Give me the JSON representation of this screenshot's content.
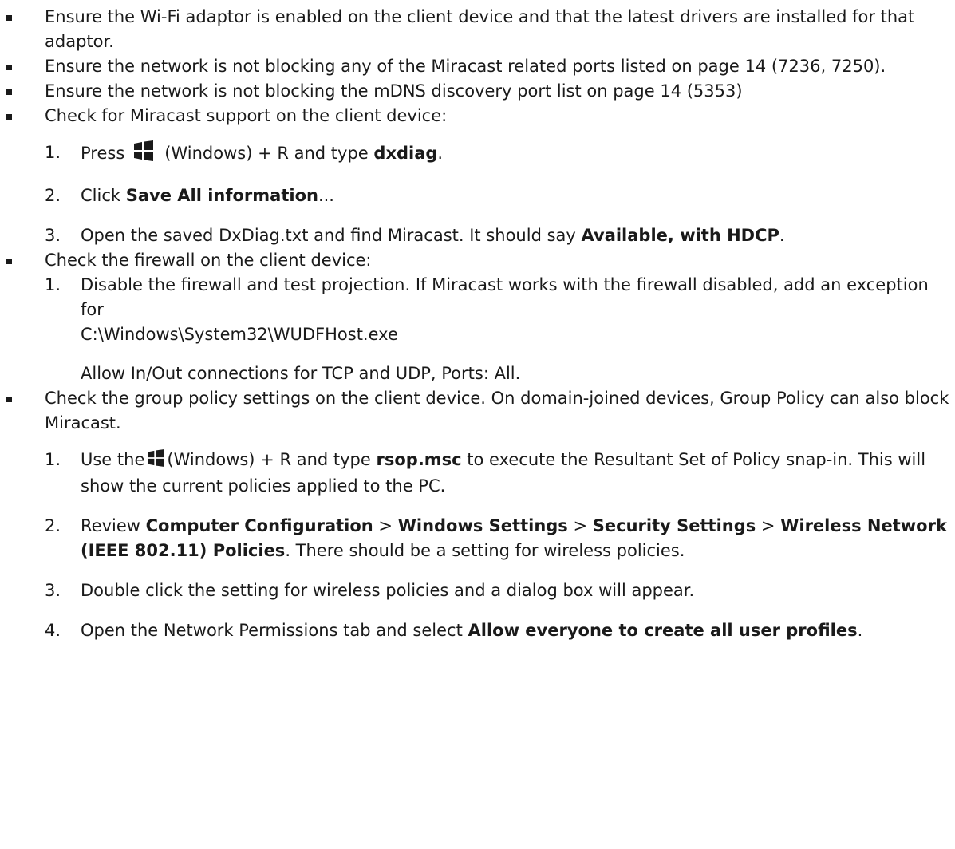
{
  "bullets": {
    "b1": "Ensure the Wi-Fi adaptor is enabled on the client device and that the latest drivers are installed for that adaptor.",
    "b2": "Ensure the network is not blocking any of the Miracast related ports listed on page 14 (7236, 7250).",
    "b3": "Ensure the network is not blocking the mDNS discovery port list on page 14 (5353)",
    "b4": "Check for Miracast support on the client device:",
    "b5": "Check the firewall on the client device:",
    "b6": "Check the group policy settings on the client device. On domain-joined devices, Group Policy can also block Miracast."
  },
  "miracast_steps": {
    "s1": {
      "num": "1.",
      "pre": "Press",
      "icon": "windows-logo-icon",
      "mid": "(Windows) + R and type ",
      "bold": "dxdiag",
      "post": "."
    },
    "s2": {
      "num": "2.",
      "pre": "Click ",
      "bold": "Save All information",
      "post": "..."
    },
    "s3": {
      "num": "3.",
      "pre": "Open the saved DxDiag.txt and find Miracast. It should say ",
      "bold": "Available, with HDCP",
      "post": "."
    }
  },
  "firewall_steps": {
    "s1": {
      "num": "1.",
      "text": "Disable the firewall and test projection. If Miracast works with the firewall disabled, add an exception for",
      "path": "C:\\Windows\\System32\\WUDFHost.exe",
      "note": "Allow In/Out connections for TCP and UDP, Ports: All."
    }
  },
  "policy_steps": {
    "s1": {
      "num": "1.",
      "pre": "Use the",
      "icon": "windows-logo-icon",
      "mid": "(Windows) + R and type ",
      "bold": "rsop.msc",
      "post": " to execute the Resultant Set of Policy snap-in. This will show the current policies applied to the PC."
    },
    "s2": {
      "num": "2.",
      "pre": "Review ",
      "b1": "Computer Configuration",
      "sep1": " > ",
      "b2": "Windows Settings",
      "sep2": " > ",
      "b3": "Security Settings",
      "sep3": " > ",
      "b4": "Wireless Network (IEEE 802.11) Policies",
      "post": ". There should be a setting for wireless policies."
    },
    "s3": {
      "num": "3.",
      "text": "Double click the setting for wireless policies and a dialog box will appear."
    },
    "s4": {
      "num": "4.",
      "pre": "Open the Network Permissions tab and select ",
      "bold": "Allow everyone to create all user profiles",
      "post": "."
    }
  },
  "colors": {
    "text": "#1a1a1a",
    "background": "#ffffff"
  }
}
